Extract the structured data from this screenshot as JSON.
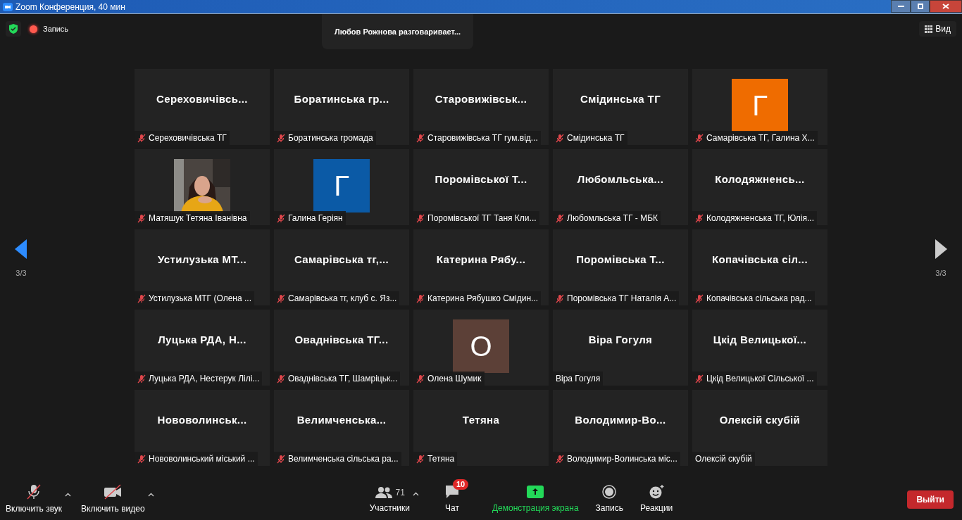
{
  "window": {
    "title": "Zoom Конференция, 40 мин"
  },
  "top_bar": {
    "recording_label": "Запись",
    "speaker_notice": "Любов Рожнова разговаривает...",
    "view_button": "Вид"
  },
  "pager": {
    "left_label": "3/3",
    "right_label": "3/3"
  },
  "tiles": [
    {
      "kind": "name",
      "title": "Сереховичівсь...",
      "label": "Сереховичівська ТГ",
      "muted": true
    },
    {
      "kind": "name",
      "title": "Боратинська  гр...",
      "label": "Боратинська громада",
      "muted": true
    },
    {
      "kind": "name",
      "title": "Старовижівськ...",
      "label": "Старовижівська ТГ гум.від...",
      "muted": true
    },
    {
      "kind": "name",
      "title": "Смідинська ТГ",
      "label": "Смідинська ТГ",
      "muted": true
    },
    {
      "kind": "avatar",
      "letter": "Г",
      "color": "#ef6c00",
      "label": "Самарівська ТГ, Галина Х...",
      "muted": true
    },
    {
      "kind": "picture",
      "label": "Матяшук Тетяна Іванівна",
      "muted": true
    },
    {
      "kind": "avatar",
      "letter": "Г",
      "color": "#0b5aa6",
      "label": "Галина Геріян",
      "muted": true
    },
    {
      "kind": "name",
      "title": "Поромівської Т...",
      "label": "Поромівської ТГ Таня Кли...",
      "muted": true
    },
    {
      "kind": "name",
      "title": "Любомльська...",
      "label": "Любомльська ТГ - МБК",
      "muted": true
    },
    {
      "kind": "name",
      "title": "Колодяжненсь...",
      "label": "Колодяжненська ТГ, Юлія...",
      "muted": true
    },
    {
      "kind": "name",
      "title": "Устилузька  МТ...",
      "label": "Устилузька МТГ  (Олена ...",
      "muted": true
    },
    {
      "kind": "name",
      "title": "Самарівська тг,...",
      "label": "Самарівська тг, клуб с. Яз...",
      "muted": true
    },
    {
      "kind": "name",
      "title": "Катерина  Рябу...",
      "label": "Катерина Рябушко Смідин...",
      "muted": true
    },
    {
      "kind": "name",
      "title": "Поромівська Т...",
      "label": "Поромівська ТГ Наталія А...",
      "muted": true
    },
    {
      "kind": "name",
      "title": "Копачівська  сіл...",
      "label": "Копачівська сільська рад...",
      "muted": true
    },
    {
      "kind": "name",
      "title": "Луцька РДА, Н...",
      "label": "Луцька РДА, Нестерук Лілі...",
      "muted": true
    },
    {
      "kind": "name",
      "title": "Оваднівська ТГ...",
      "label": "Оваднівська ТГ, Шамріцьк...",
      "muted": true
    },
    {
      "kind": "avatar",
      "letter": "О",
      "color": "#5c4037",
      "label": "Олена Шумик",
      "muted": true
    },
    {
      "kind": "name",
      "title": "Віра Гогуля",
      "label": "Віра Гогуля",
      "muted": false
    },
    {
      "kind": "name",
      "title": "Цкід  Велицької...",
      "label": "Цкід Велицької Сільської ...",
      "muted": true
    },
    {
      "kind": "name",
      "title": "Нововолинськ...",
      "label": "Нововолинський міський ...",
      "muted": true
    },
    {
      "kind": "name",
      "title": "Велимченська...",
      "label": "Велимченська сільська ра...",
      "muted": true
    },
    {
      "kind": "name",
      "title": "Тетяна",
      "label": "Тетяна",
      "muted": true
    },
    {
      "kind": "name",
      "title": "Володимир-Во...",
      "label": "Володимир-Волинська міс...",
      "muted": true
    },
    {
      "kind": "name",
      "title": "Олексій скубій",
      "label": "Олексій скубій",
      "muted": false
    }
  ],
  "toolbar": {
    "audio": "Включить звук",
    "video": "Включить видео",
    "participants_count": "71",
    "participants": "Участники",
    "chat": "Чат",
    "chat_badge": "10",
    "share": "Демонстрация экрана",
    "record": "Запись",
    "reactions": "Реакции",
    "leave": "Выйти"
  }
}
